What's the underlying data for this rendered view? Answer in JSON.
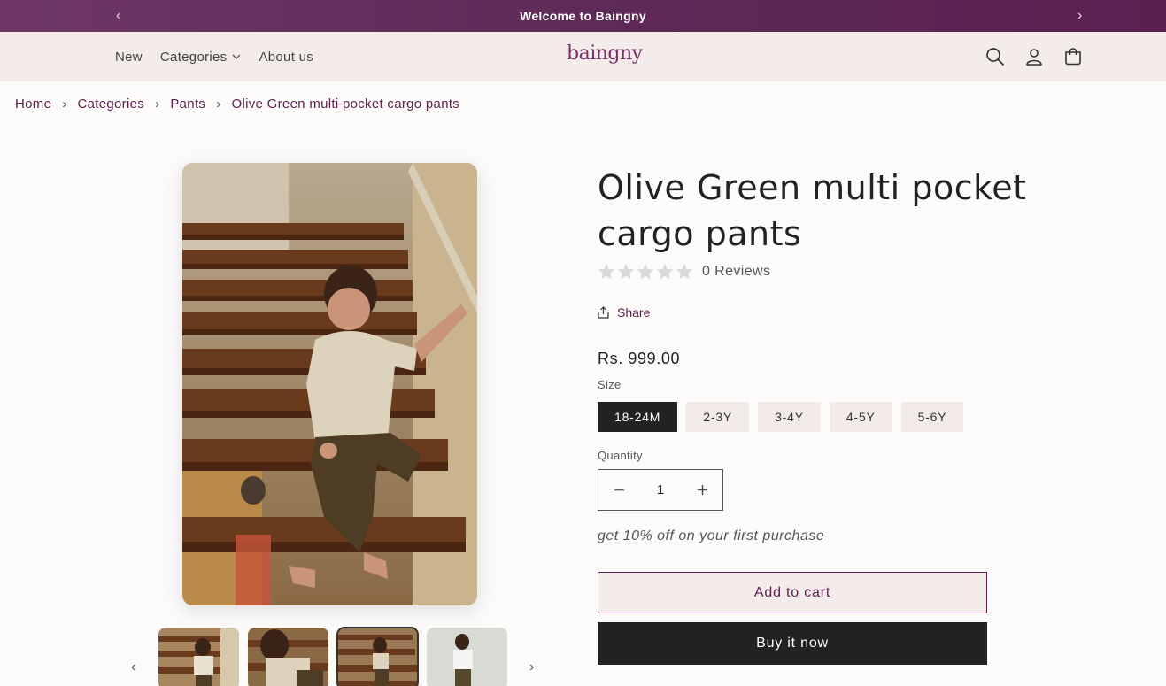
{
  "announcement": {
    "message": "Welcome to Baingny",
    "prev_icon": "chevron-left-icon",
    "next_icon": "chevron-right-icon"
  },
  "header": {
    "logo": "baingny",
    "nav": [
      {
        "label": "New"
      },
      {
        "label": "Categories",
        "has_dropdown": true
      },
      {
        "label": "About us"
      }
    ],
    "icons": [
      "search-icon",
      "account-icon",
      "cart-icon"
    ]
  },
  "breadcrumb": [
    "Home",
    "Categories",
    "Pants",
    "Olive Green multi pocket cargo pants"
  ],
  "product": {
    "title": "Olive Green multi pocket cargo pants",
    "rating": 0,
    "reviews_label": "0 Reviews",
    "share_label": "Share",
    "price": "Rs. 999.00",
    "size_label": "Size",
    "sizes": [
      "18-24M",
      "2-3Y",
      "3-4Y",
      "4-5Y",
      "5-6Y"
    ],
    "selected_size": "18-24M",
    "quantity_label": "Quantity",
    "quantity": "1",
    "promo": "get 10% off on your first purchase",
    "add_to_cart": "Add to cart",
    "buy_now": "Buy it now"
  },
  "gallery": {
    "thumbnail_count": 4,
    "active_thumbnail": 3
  },
  "colors": {
    "accent": "#5a1f4d",
    "announce_bg": "#5e2a56",
    "header_bg": "#f3ecea",
    "button_dark": "#222222"
  }
}
